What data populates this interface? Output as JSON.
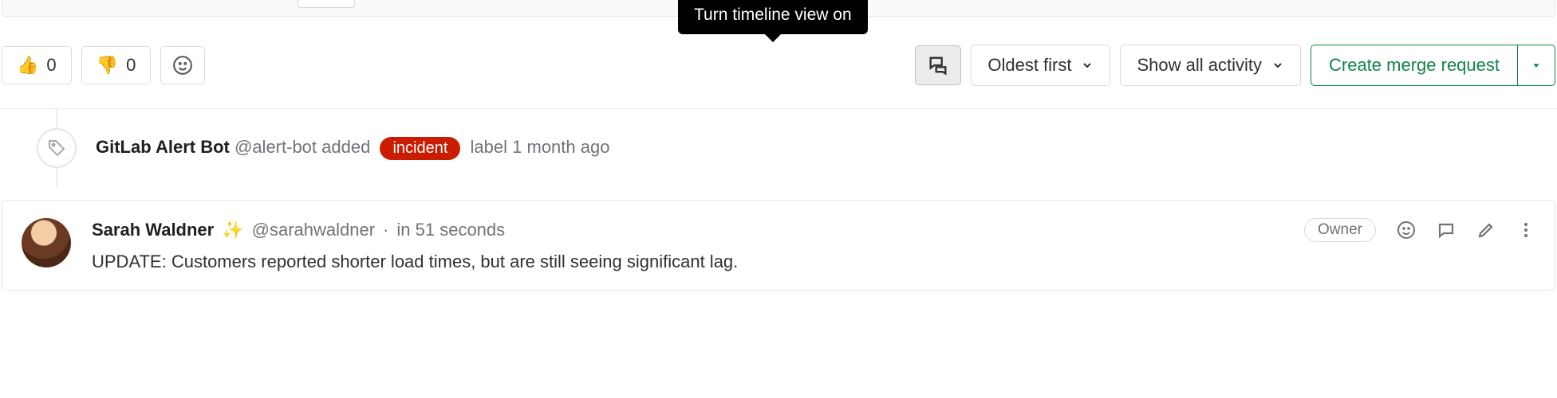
{
  "tooltip": {
    "timeline_toggle": "Turn timeline view on"
  },
  "reactions": {
    "thumbs_up_count": "0",
    "thumbs_down_count": "0"
  },
  "filters": {
    "sort_label": "Oldest first",
    "activity_label": "Show all activity"
  },
  "merge_request": {
    "create_label": "Create merge request"
  },
  "system_note": {
    "author_name": "GitLab Alert Bot",
    "author_handle": "@alert-bot",
    "action_text": "added",
    "label_name": "incident",
    "trailing_text": "label",
    "time_text": "1 month ago"
  },
  "comment": {
    "author_name": "Sarah Waldner",
    "author_emoji": "✨",
    "author_handle": "@sarahwaldner",
    "time_text": "in 51 seconds",
    "badge": "Owner",
    "body": "UPDATE: Customers reported shorter load times, but are still seeing significant lag."
  }
}
